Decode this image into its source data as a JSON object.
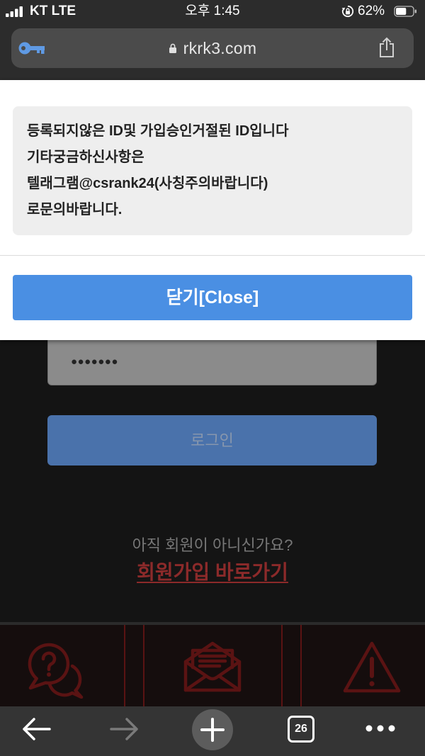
{
  "status_bar": {
    "carrier": "KT LTE",
    "time": "오후 1:45",
    "battery_text": "62%",
    "battery_level": 0.62,
    "icons": [
      "signal-icon",
      "rotation-lock-icon",
      "battery-icon"
    ]
  },
  "browser": {
    "url": "rkrk3.com",
    "icons": [
      "key-icon",
      "lock-icon",
      "share-icon"
    ]
  },
  "modal": {
    "message_lines": [
      "등록되지않은 ID및 가입승인거절된 ID입니다",
      "기타궁금하신사항은",
      "텔래그램@csrank24(사칭주의바랍니다)",
      "로문의바랍니다."
    ],
    "close_label": "닫기[Close]"
  },
  "login": {
    "password_mask": "●●●●●●●",
    "login_label": "로그인",
    "signup_prompt": "아직 회원이 아니신가요?",
    "signup_link": "회원가입 바로가기"
  },
  "footer": {
    "items": [
      {
        "icon": "question-chat-icon"
      },
      {
        "icon": "envelope-icon"
      },
      {
        "icon": "warning-icon"
      }
    ]
  },
  "toolbar": {
    "tab_count": "26",
    "icons": [
      "back-arrow-icon",
      "forward-arrow-icon",
      "plus-icon",
      "tabs-icon",
      "more-icon"
    ]
  },
  "colors": {
    "chrome_bg": "#2c2c2c",
    "url_bar_bg": "#4b4b4b",
    "key_blue": "#5f9ae4",
    "modal_bg": "#ffffff",
    "message_box_bg": "#eeeeee",
    "close_button_bg": "#4a8fe3",
    "page_bg": "#141414",
    "password_bg": "#8b8b8b",
    "login_button_bg": "#4a72ab",
    "signup_link_red": "#8c2a2a",
    "footer_red": "#5a1313",
    "toolbar_bg": "#343434"
  }
}
